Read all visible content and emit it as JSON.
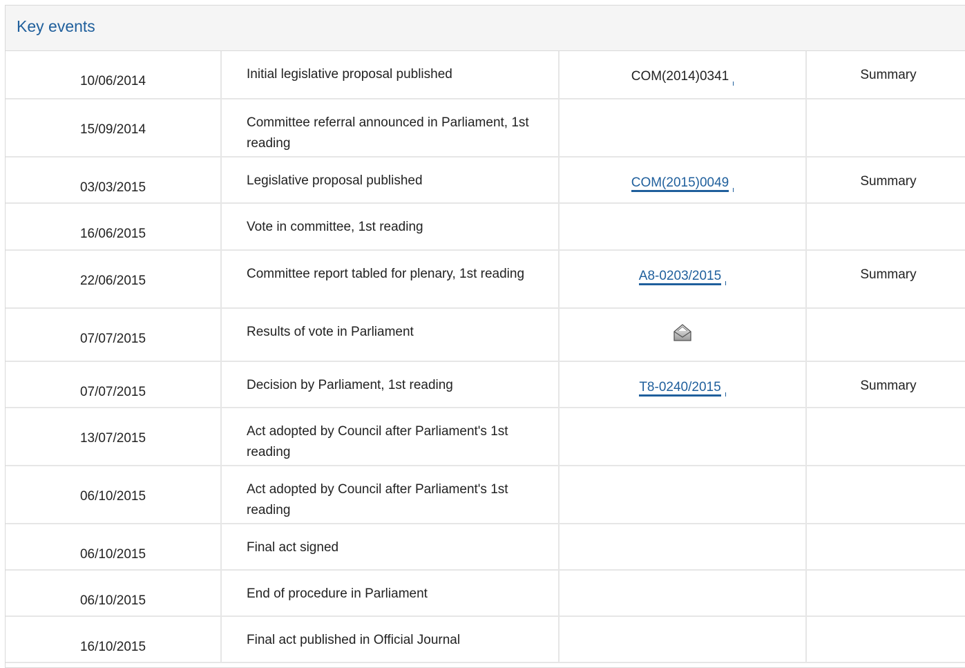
{
  "panel": {
    "title": "Key events"
  },
  "rows": [
    {
      "date": "10/06/2014",
      "event": "Initial legislative proposal published",
      "doc": "COM(2014)0341",
      "doc_link": false,
      "summary": "Summary"
    },
    {
      "date": "15/09/2014",
      "event": "Committee referral announced in Parliament, 1st reading",
      "doc": "",
      "doc_link": false,
      "summary": ""
    },
    {
      "date": "03/03/2015",
      "event": "Legislative proposal published",
      "doc": "COM(2015)0049",
      "doc_link": true,
      "summary": "Summary"
    },
    {
      "date": "16/06/2015",
      "event": "Vote in committee, 1st reading",
      "doc": "",
      "doc_link": false,
      "summary": ""
    },
    {
      "date": "22/06/2015",
      "event": "Committee report tabled for plenary, 1st reading",
      "doc": "A8-0203/2015",
      "doc_link": true,
      "summary": "Summary"
    },
    {
      "date": "07/07/2015",
      "event": "Results of vote in Parliament",
      "doc": "",
      "doc_icon": "ballot-box-icon",
      "doc_link": false,
      "summary": ""
    },
    {
      "date": "07/07/2015",
      "event": "Decision by Parliament, 1st reading",
      "doc": "T8-0240/2015",
      "doc_link": true,
      "summary": "Summary"
    },
    {
      "date": "13/07/2015",
      "event": "Act adopted by Council after Parliament's 1st reading",
      "doc": "",
      "doc_link": false,
      "summary": ""
    },
    {
      "date": "06/10/2015",
      "event": "Act adopted by Council after Parliament's 1st reading",
      "doc": "",
      "doc_link": false,
      "summary": ""
    },
    {
      "date": "06/10/2015",
      "event": "Final act signed",
      "doc": "",
      "doc_link": false,
      "summary": ""
    },
    {
      "date": "06/10/2015",
      "event": "End of procedure in Parliament",
      "doc": "",
      "doc_link": false,
      "summary": ""
    },
    {
      "date": "16/10/2015",
      "event": "Final act published in Official Journal",
      "doc": "",
      "doc_link": false,
      "summary": ""
    }
  ],
  "colors": {
    "accent": "#1f5f9c",
    "header_bg": "#f5f5f5",
    "border": "#e6e6e6"
  }
}
